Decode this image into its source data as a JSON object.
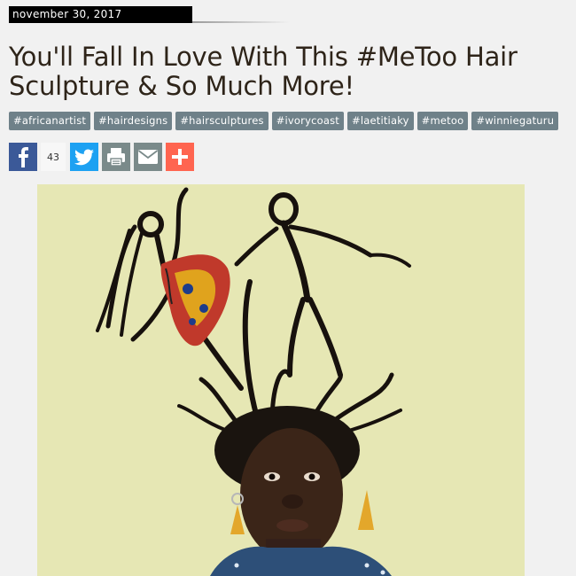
{
  "post": {
    "date": "november 30, 2017",
    "title": "You'll Fall In Love With This #MeToo Hair Sculpture & So Much More!"
  },
  "tags": [
    "#africanartist",
    "#hairdesigns",
    "#hairsculptures",
    "#ivorycoast",
    "#laetitiaky",
    "#metoo",
    "#winniegaturu"
  ],
  "share": {
    "facebook_count": "43",
    "buttons": [
      "facebook-icon",
      "twitter-icon",
      "print-icon",
      "email-icon",
      "plus-icon"
    ]
  },
  "colors": {
    "tag_bg": "#6f8189",
    "facebook": "#3b5998",
    "twitter": "#1da1f2",
    "print": "#7a8a8a",
    "email": "#7a8a8a",
    "more": "#ff6550",
    "photo_bg": "#e6e7b4"
  }
}
